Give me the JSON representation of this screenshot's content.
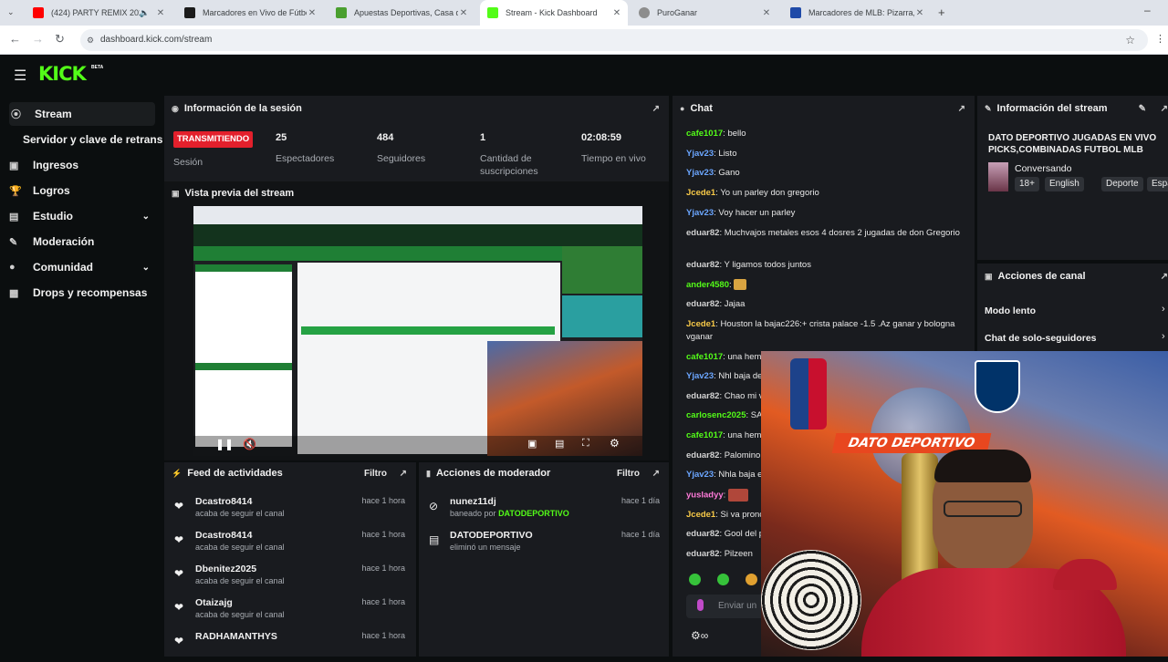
{
  "browser": {
    "tabs": [
      {
        "title": "(424) PARTY REMIX 2025 - I",
        "color": "#ff0000"
      },
      {
        "title": "Marcadores en Vivo de Fútbol",
        "color": "#1b1b1b"
      },
      {
        "title": "Apuestas Deportivas, Casa de A",
        "color": "#4a9f2f"
      },
      {
        "title": "Stream - Kick Dashboard",
        "color": "#53fc18"
      },
      {
        "title": "PuroGanar",
        "color": "#8d8d8d"
      },
      {
        "title": "Marcadores de MLB: Pizarra, Re",
        "color": "#1f4aa8"
      }
    ],
    "url": "dashboard.kick.com/stream"
  },
  "app": {
    "logo": "KICK",
    "logo_badge": "BETA"
  },
  "sidebar": {
    "items": [
      {
        "label": "Stream",
        "icon": "stream-icon"
      },
      {
        "label": "Servidor y clave de retransmisión",
        "icon": ""
      },
      {
        "label": "Ingresos",
        "icon": "chart-icon"
      },
      {
        "label": "Logros",
        "icon": "trophy-icon"
      },
      {
        "label": "Estudio",
        "icon": "book-icon"
      },
      {
        "label": "Moderación",
        "icon": "wrench-icon"
      },
      {
        "label": "Comunidad",
        "icon": "users-icon"
      },
      {
        "label": "Drops y recompensas",
        "icon": "drops-icon"
      }
    ]
  },
  "session": {
    "title": "Información de la sesión",
    "status_badge": "TRANSMITIENDO",
    "status_label": "Sesión",
    "stats": [
      {
        "value": "25",
        "label": "Espectadores"
      },
      {
        "value": "484",
        "label": "Seguidores"
      },
      {
        "value": "1",
        "label": "Cantidad de suscripciones"
      },
      {
        "value": "02:08:59",
        "label": "Tiempo en vivo"
      }
    ]
  },
  "preview": {
    "title": "Vista previa del stream"
  },
  "activity": {
    "title": "Feed de actividades",
    "filter": "Filtro",
    "rows": [
      {
        "name": "Dcastro8414",
        "desc": "acaba de seguir el canal",
        "time": "hace 1 hora"
      },
      {
        "name": "Dcastro8414",
        "desc": "acaba de seguir el canal",
        "time": "hace 1 hora"
      },
      {
        "name": "Dbenitez2025",
        "desc": "acaba de seguir el canal",
        "time": "hace 1 hora"
      },
      {
        "name": "Otaizajg",
        "desc": "acaba de seguir el canal",
        "time": "hace 1 hora"
      },
      {
        "name": "RADHAMANTHYS",
        "desc": "acaba de seguir el canal",
        "time": "hace 1 hora"
      }
    ]
  },
  "moderator": {
    "title": "Acciones de moderador",
    "filter": "Filtro",
    "rows": [
      {
        "name": "nunez11dj",
        "desc": "baneado por",
        "by": "DATODEPORTIVO",
        "time": "hace 1 día"
      },
      {
        "name": "DATODEPORTIVO",
        "desc": "eliminó un mensaje",
        "time": "hace 1 día"
      }
    ]
  },
  "chat": {
    "title": "Chat",
    "input_placeholder": "Enviar un",
    "messages": [
      {
        "user": "cafe1017",
        "text": "bello",
        "color": "#53fc18"
      },
      {
        "user": "Yjav23",
        "text": "Listo",
        "color": "#6ba6ff"
      },
      {
        "user": "Yjav23",
        "text": "Gano",
        "color": "#6ba6ff"
      },
      {
        "user": "Jcede1",
        "text": "Yo un parley don gregorio",
        "color": "#f7c948"
      },
      {
        "user": "Yjav23",
        "text": "Voy hacer un parley",
        "color": "#6ba6ff"
      },
      {
        "user": "eduar82",
        "text": "Muchvajos metales esos 4 dosres 2 jugadas de don Gregorio",
        "color": "#d2d2d2"
      },
      {
        "user": "eduar82",
        "text": "Y ligamos todos juntos",
        "color": "#d2d2d2"
      },
      {
        "user": "ander4580",
        "text": "",
        "color": "#53fc18"
      },
      {
        "user": "eduar82",
        "text": "Jajaa",
        "color": "#d2d2d2"
      },
      {
        "user": "Jcede1",
        "text": "Houston la bajac226:+ crista palace -1.5 .Az ganar y bologna vganar",
        "color": "#f7c948"
      },
      {
        "user": "cafe1017",
        "text": "una hemi",
        "color": "#53fc18"
      },
      {
        "user": "Yjav23",
        "text": "Nhl baja de",
        "color": "#6ba6ff"
      },
      {
        "user": "eduar82",
        "text": "Chao mi v",
        "color": "#d2d2d2"
      },
      {
        "user": "carlosenc2025",
        "text": "SA",
        "color": "#53fc18"
      },
      {
        "user": "cafe1017",
        "text": "una hemi",
        "color": "#53fc18"
      },
      {
        "user": "eduar82",
        "text": "Palomino",
        "color": "#d2d2d2"
      },
      {
        "user": "Yjav23",
        "text": "Nhla baja e",
        "color": "#6ba6ff"
      },
      {
        "user": "yusladyy",
        "text": "",
        "color": "#ff7ad9"
      },
      {
        "user": "Jcede1",
        "text": "Si va pronc",
        "color": "#f7c948"
      },
      {
        "user": "eduar82",
        "text": "Gool del p",
        "color": "#d2d2d2"
      },
      {
        "user": "eduar82",
        "text": "Pilzeen",
        "color": "#d2d2d2"
      }
    ]
  },
  "stream_info": {
    "title": "Información del stream",
    "stream_title": "DATO DEPORTIVO JUGADAS EN VIVO PICKS,COMBINADAS FUTBOL MLB",
    "category": "Conversando",
    "tags": [
      "18+",
      "English",
      "Deporte",
      "Espa"
    ]
  },
  "channel_actions": {
    "title": "Acciones de canal",
    "items": [
      "Modo lento",
      "Chat de solo-seguidores"
    ]
  },
  "webcam": {
    "overlay_text": "DATO DEPORTIVO"
  }
}
